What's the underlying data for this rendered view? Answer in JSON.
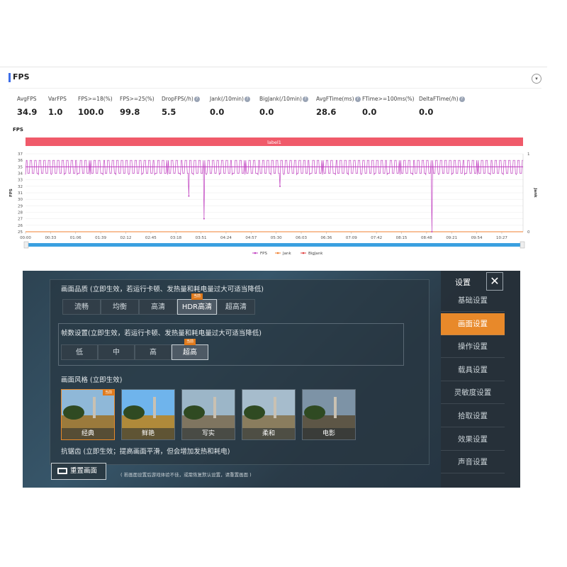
{
  "fps_panel": {
    "title": "FPS",
    "collapse_icon": "chevron-down-icon",
    "metrics": [
      {
        "label": "AvgFPS",
        "value": "34.9",
        "help": false
      },
      {
        "label": "VarFPS",
        "value": "1.0",
        "help": false
      },
      {
        "label": "FPS>=18(%)",
        "value": "100.0",
        "help": false
      },
      {
        "label": "FPS>=25(%)",
        "value": "99.8",
        "help": false
      },
      {
        "label": "DropFPS(/h)",
        "value": "5.5",
        "help": true
      },
      {
        "label": "Jank(/10min)",
        "value": "0.0",
        "help": true
      },
      {
        "label": "BigJank(/10min)",
        "value": "0.0",
        "help": true
      },
      {
        "label": "AvgFTime(ms)",
        "value": "28.6",
        "help": true
      },
      {
        "label": "FTime>=100ms(%)",
        "value": "0.0",
        "help": false
      },
      {
        "label": "DeltaFTime(/h)",
        "value": "0.0",
        "help": true
      }
    ],
    "chart_label": "FPS"
  },
  "chart_data": {
    "type": "line",
    "title": "FPS",
    "label_band": "label1",
    "x_ticks": [
      "00:00",
      "00:33",
      "01:06",
      "01:39",
      "02:12",
      "02:45",
      "03:18",
      "03:51",
      "04:24",
      "04:57",
      "05:30",
      "06:03",
      "06:36",
      "07:09",
      "07:42",
      "08:15",
      "08:48",
      "09:21",
      "09:54",
      "10:27"
    ],
    "xlim_seconds": [
      0,
      655
    ],
    "y_left": {
      "label": "FPS",
      "ticks": [
        25,
        26,
        27,
        28,
        29,
        30,
        31,
        32,
        33,
        34,
        35,
        36,
        37
      ],
      "ylim": [
        25,
        37
      ]
    },
    "y_right": {
      "label": "Jank",
      "ticks": [
        0,
        1
      ],
      "ylim": [
        0,
        1
      ]
    },
    "series": [
      {
        "name": "FPS",
        "color": "#c040c0",
        "baseline": 35,
        "oscillation": [
          34,
          36
        ],
        "drops": [
          {
            "x": 215,
            "y": 30.5
          },
          {
            "x": 235,
            "y": 27.0
          },
          {
            "x": 335,
            "y": 32.0
          },
          {
            "x": 535,
            "y": 25.0
          }
        ]
      },
      {
        "name": "Jank",
        "color": "#f08030",
        "values_constant": 0
      },
      {
        "name": "BigJank",
        "color": "#e04040",
        "values_constant": 0
      }
    ],
    "legend": "bottom-center",
    "grid": true,
    "colors": {
      "band": "#f05a6a",
      "scroll": "#3aa0e0"
    }
  },
  "game": {
    "quality_title": "画面品质 (立即生效，若运行卡顿、发热量和耗电量过大可适当降低)",
    "quality_options": [
      "流畅",
      "均衡",
      "高清",
      "HDR高清",
      "超高清"
    ],
    "quality_selected": "HDR高清",
    "current_badge": "当前",
    "fps_title": "帧数设置(立即生效，若运行卡顿、发热量和耗电量过大可适当降低)",
    "fps_options": [
      "低",
      "中",
      "高",
      "超高"
    ],
    "fps_selected": "超高",
    "style_title": "画面风格 (立即生效)",
    "styles": [
      "经典",
      "鲜艳",
      "写实",
      "柔和",
      "电影"
    ],
    "style_selected": "经典",
    "aa_title": "抗锯齿 (立即生效；提高画面平滑，但会增加发热和耗电)",
    "reset_label": "重置画面",
    "reset_icon": "refresh-icon",
    "reset_hint": "( 若画面设置后游戏体验不佳，或需恢复默认设置，请重置画面 )",
    "sidebar_title": "设置",
    "close_icon": "close-icon",
    "sidebar_items": [
      "基础设置",
      "画面设置",
      "操作设置",
      "载具设置",
      "灵敏度设置",
      "拾取设置",
      "效果设置",
      "声音设置"
    ],
    "sidebar_active": "画面设置",
    "colors": {
      "accent": "#e8892a"
    }
  }
}
